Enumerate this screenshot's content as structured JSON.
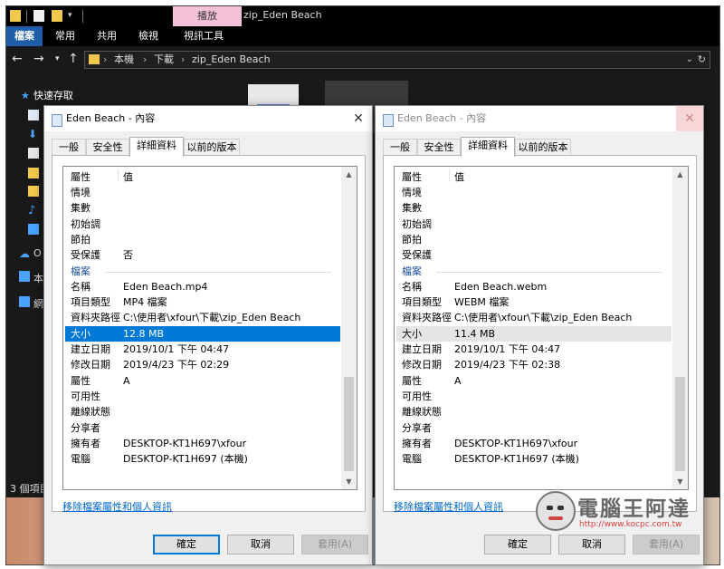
{
  "explorer": {
    "window_title": "zip_Eden Beach",
    "context_tab": "播放",
    "ribbon_tabs": [
      "檔案",
      "常用",
      "共用",
      "檢視",
      "視訊工具"
    ],
    "breadcrumb": [
      "本機",
      "下載",
      "zip_Eden Beach"
    ],
    "nav": {
      "quick_access": "快速存取",
      "item_o": "O",
      "item_ben": "本",
      "item_wang": "網"
    },
    "status": "3 個項目"
  },
  "dialogs": [
    {
      "title": "Eden Beach - 內容",
      "active": true,
      "tabs": [
        "一般",
        "安全性",
        "詳細資料",
        "以前的版本"
      ],
      "header": {
        "property": "屬性",
        "value": "值"
      },
      "rows": [
        {
          "k": "情境",
          "v": ""
        },
        {
          "k": "集數",
          "v": ""
        },
        {
          "k": "初始調",
          "v": ""
        },
        {
          "k": "節拍",
          "v": ""
        },
        {
          "k": "受保護",
          "v": "否"
        },
        {
          "k": "檔案",
          "v": "",
          "section": true
        },
        {
          "k": "名稱",
          "v": "Eden Beach.mp4"
        },
        {
          "k": "項目類型",
          "v": "MP4 檔案"
        },
        {
          "k": "資料夾路徑",
          "v": "C:\\使用者\\xfour\\下載\\zip_Eden Beach"
        },
        {
          "k": "大小",
          "v": "12.8 MB",
          "state": "sel"
        },
        {
          "k": "建立日期",
          "v": "2019/10/1 下午 04:47"
        },
        {
          "k": "修改日期",
          "v": "2019/4/23 下午 02:29"
        },
        {
          "k": "屬性",
          "v": "A"
        },
        {
          "k": "可用性",
          "v": ""
        },
        {
          "k": "離線狀態",
          "v": ""
        },
        {
          "k": "分享者",
          "v": ""
        },
        {
          "k": "擁有者",
          "v": "DESKTOP-KT1H697\\xfour"
        },
        {
          "k": "電腦",
          "v": "DESKTOP-KT1H697 (本機)"
        }
      ],
      "remove_link": "移除檔案屬性和個人資訊",
      "buttons": {
        "ok": "確定",
        "cancel": "取消",
        "apply": "套用(A)"
      }
    },
    {
      "title": "Eden Beach - 內容",
      "active": false,
      "tabs": [
        "一般",
        "安全性",
        "詳細資料",
        "以前的版本"
      ],
      "header": {
        "property": "屬性",
        "value": "值"
      },
      "rows": [
        {
          "k": "情境",
          "v": ""
        },
        {
          "k": "集數",
          "v": ""
        },
        {
          "k": "初始調",
          "v": ""
        },
        {
          "k": "節拍",
          "v": ""
        },
        {
          "k": "受保護",
          "v": ""
        },
        {
          "k": "檔案",
          "v": "",
          "section": true
        },
        {
          "k": "名稱",
          "v": "Eden Beach.webm"
        },
        {
          "k": "項目類型",
          "v": "WEBM 檔案"
        },
        {
          "k": "資料夾路徑",
          "v": "C:\\使用者\\xfour\\下載\\zip_Eden Beach"
        },
        {
          "k": "大小",
          "v": "11.4 MB",
          "state": "hover"
        },
        {
          "k": "建立日期",
          "v": "2019/10/1 下午 04:47"
        },
        {
          "k": "修改日期",
          "v": "2019/4/23 下午 02:38"
        },
        {
          "k": "屬性",
          "v": "A"
        },
        {
          "k": "可用性",
          "v": ""
        },
        {
          "k": "離線狀態",
          "v": ""
        },
        {
          "k": "分享者",
          "v": ""
        },
        {
          "k": "擁有者",
          "v": "DESKTOP-KT1H697\\xfour"
        },
        {
          "k": "電腦",
          "v": "DESKTOP-KT1H697 (本機)"
        }
      ],
      "remove_link": "移除檔案屬性和個人資訊",
      "buttons": {
        "ok": "確定",
        "cancel": "取消",
        "apply": "套用(A)"
      }
    }
  ],
  "watermark": {
    "brand": "電腦王阿達",
    "url": "http://www.kocpc.com.tw"
  },
  "colors": {
    "accent": "#0078d7",
    "link": "#0066cc",
    "section": "#1c4e9c",
    "context_tab": "#f3c1d8"
  }
}
